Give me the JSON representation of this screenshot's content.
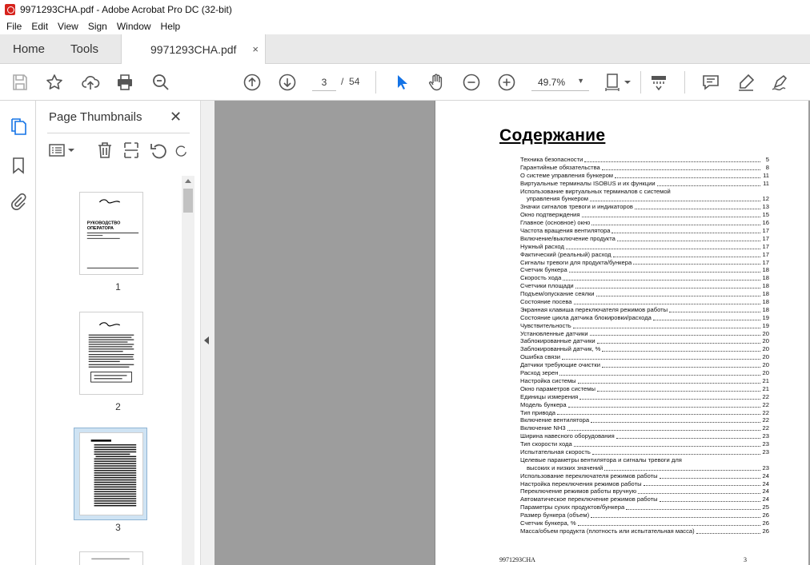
{
  "window": {
    "title": "9971293CHA.pdf - Adobe Acrobat Pro DC (32-bit)"
  },
  "menu": [
    "File",
    "Edit",
    "View",
    "Sign",
    "Window",
    "Help"
  ],
  "tabs": {
    "home": "Home",
    "tools": "Tools",
    "doc": "9971293CHA.pdf",
    "close": "×"
  },
  "toolbar": {
    "page_current": "3",
    "page_sep": "/",
    "page_total": "54",
    "zoom": "49.7%"
  },
  "panel": {
    "title": "Page Thumbnails",
    "close": "✕"
  },
  "thumbnails": [
    {
      "label": "1"
    },
    {
      "label": "2"
    },
    {
      "label": "3"
    }
  ],
  "thumb1": {
    "line1": "РУКОВОДСТВО",
    "line2": "ОПЕРАТОРА"
  },
  "document": {
    "heading": "Содержание",
    "footer_left": "9971293CHA",
    "footer_right": "3",
    "toc": [
      {
        "label": "Техника безопасности",
        "page": "5"
      },
      {
        "label": "Гарантийные обязательства",
        "page": "8"
      },
      {
        "label": "О системе управления бункером",
        "page": "11"
      },
      {
        "label": "Виртуальные терминалы ISOBUS и их функции",
        "page": "11"
      },
      {
        "label": "Использование виртуальных терминалов с системой",
        "page": ""
      },
      {
        "label": "управления бункером",
        "page": "12",
        "cont": true
      },
      {
        "label": "Значки сигналов тревоги и индикаторов",
        "page": "13"
      },
      {
        "label": "Окно подтверждения",
        "page": "15"
      },
      {
        "label": "Главное (основное) окно",
        "page": "16"
      },
      {
        "label": "Частота вращения вентилятора",
        "page": "17"
      },
      {
        "label": "Включение/выключение продукта",
        "page": "17"
      },
      {
        "label": "Нужный расход",
        "page": "17"
      },
      {
        "label": "Фактический (реальный) расход",
        "page": "17"
      },
      {
        "label": "Сигналы тревоги для продукта/бункера",
        "page": "17"
      },
      {
        "label": "Счетчик бункера",
        "page": "18"
      },
      {
        "label": "Скорость хода",
        "page": "18"
      },
      {
        "label": "Счетчики площади",
        "page": "18"
      },
      {
        "label": "Подъем/опускание сеялки",
        "page": "18"
      },
      {
        "label": "Состояние посева",
        "page": "18"
      },
      {
        "label": "Экранная клавиша переключателя режимов работы",
        "page": "18"
      },
      {
        "label": "Состояние цикла датчика блокировки/расхода",
        "page": "19"
      },
      {
        "label": "Чувствительность",
        "page": "19"
      },
      {
        "label": "Установленные датчики",
        "page": "20"
      },
      {
        "label": "Заблокированные датчики",
        "page": "20"
      },
      {
        "label": "Заблокированный датчик, %",
        "page": "20"
      },
      {
        "label": "Ошибка связи",
        "page": "20"
      },
      {
        "label": "Датчики требующие очистки",
        "page": "20"
      },
      {
        "label": "Расход зерен",
        "page": "20"
      },
      {
        "label": "Настройка системы",
        "page": "21"
      },
      {
        "label": "Окно параметров системы",
        "page": "21"
      },
      {
        "label": "Единицы измерения",
        "page": "22"
      },
      {
        "label": "Модель бункера",
        "page": "22"
      },
      {
        "label": "Тип привода",
        "page": "22"
      },
      {
        "label": "Включение вентилятора",
        "page": "22"
      },
      {
        "label": "Включение NH3",
        "page": "22"
      },
      {
        "label": "Ширина навесного оборудования",
        "page": "23"
      },
      {
        "label": "Тип скорости хода",
        "page": "23"
      },
      {
        "label": "Испытательная скорость",
        "page": "23"
      },
      {
        "label": "Целевые параметры вентилятора и сигналы тревоги для",
        "page": ""
      },
      {
        "label": "высоких и низких значений",
        "page": "23",
        "cont": true
      },
      {
        "label": "Использование переключателя режимов работы",
        "page": "24"
      },
      {
        "label": "Настройка переключения режимов работы",
        "page": "24"
      },
      {
        "label": "Переключение режимов работы вручную",
        "page": "24"
      },
      {
        "label": "Автоматическое переключение режимов работы",
        "page": "24"
      },
      {
        "label": "Параметры сухих продуктов/бункера",
        "page": "25"
      },
      {
        "label": "Размер бункера (объем)",
        "page": "26"
      },
      {
        "label": "Счетчик бункера, %",
        "page": "26"
      },
      {
        "label": "Масса/объем продукта (плотность или испытательная масса)",
        "page": "26"
      }
    ]
  }
}
